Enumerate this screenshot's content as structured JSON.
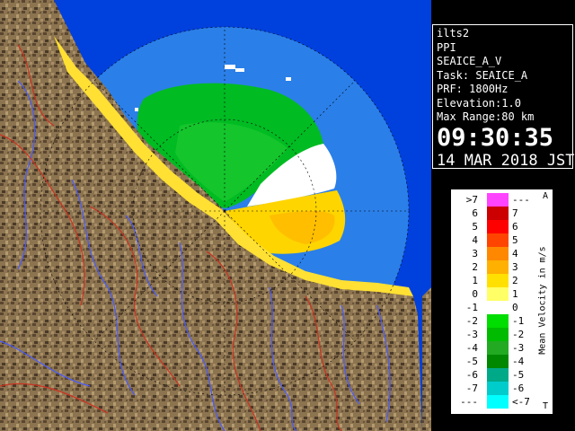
{
  "info": {
    "site": "ilts2",
    "scan_type": "PPI",
    "product": "SEAICE_A_V",
    "task": "Task: SEAICE_A",
    "prf": "PRF: 1800Hz",
    "elevation": "Elevation:1.0",
    "max_range": "Max Range:80 km",
    "time": "09:30:35",
    "date": "14 MAR 2018 JST"
  },
  "legend": {
    "title": "Mean Velocity in m/s",
    "top_mark": "A",
    "bottom_mark": "T",
    "rows": [
      {
        "left": ">7",
        "right": "---",
        "color": "#ff44ff"
      },
      {
        "left": "6",
        "right": "7",
        "color": "#cc0000"
      },
      {
        "left": "5",
        "right": "6",
        "color": "#ff0000"
      },
      {
        "left": "4",
        "right": "5",
        "color": "#ff4400"
      },
      {
        "left": "3",
        "right": "4",
        "color": "#ff8800"
      },
      {
        "left": "2",
        "right": "3",
        "color": "#ffb000"
      },
      {
        "left": "1",
        "right": "2",
        "color": "#ffe000"
      },
      {
        "left": "0",
        "right": "1",
        "color": "#ffff66"
      },
      {
        "left": "-1",
        "right": "0",
        "color": "#ffffff"
      },
      {
        "left": "-2",
        "right": "-1",
        "color": "#00dd00"
      },
      {
        "left": "-3",
        "right": "-2",
        "color": "#00bb00"
      },
      {
        "left": "-4",
        "right": "-3",
        "color": "#22aa22"
      },
      {
        "left": "-5",
        "right": "-4",
        "color": "#008800"
      },
      {
        "left": "-6",
        "right": "-5",
        "color": "#00aa88"
      },
      {
        "left": "-7",
        "right": "-6",
        "color": "#00cccc"
      },
      {
        "left": "---",
        "right": "<-7",
        "color": "#00ffff"
      }
    ]
  },
  "colors": {
    "ocean": "#0044dd",
    "coverage": "#2b7fe8",
    "land": "#8a7048",
    "approach": "#00bb22",
    "recede": "#ffd500",
    "nearzero": "#ffffff",
    "river": "#4455ff",
    "border": "#cc3322"
  }
}
